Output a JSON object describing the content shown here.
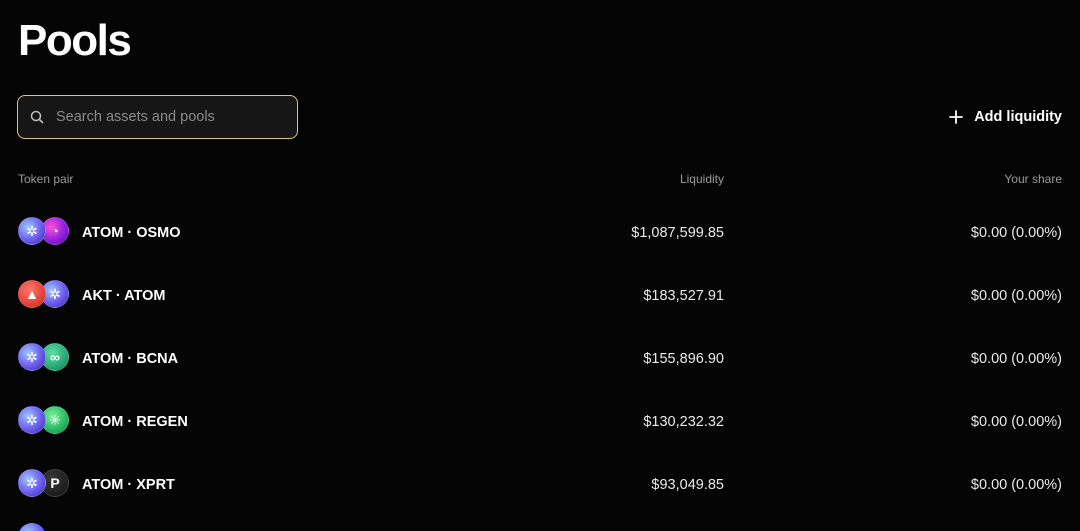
{
  "page": {
    "title": "Pools"
  },
  "search": {
    "placeholder": "Search assets and pools",
    "value": ""
  },
  "actions": {
    "add_liquidity_label": "Add liquidity"
  },
  "table": {
    "headers": {
      "token_pair": "Token pair",
      "liquidity": "Liquidity",
      "your_share": "Your share"
    },
    "rows": [
      {
        "pair": "ATOM · OSMO",
        "liquidity": "$1,087,599.85",
        "share": "$0.00 (0.00%)",
        "token1": "atom",
        "token2": "osmo"
      },
      {
        "pair": "AKT · ATOM",
        "liquidity": "$183,527.91",
        "share": "$0.00 (0.00%)",
        "token1": "akt",
        "token2": "atom"
      },
      {
        "pair": "ATOM · BCNA",
        "liquidity": "$155,896.90",
        "share": "$0.00 (0.00%)",
        "token1": "atom",
        "token2": "bcna"
      },
      {
        "pair": "ATOM · REGEN",
        "liquidity": "$130,232.32",
        "share": "$0.00 (0.00%)",
        "token1": "atom",
        "token2": "regen"
      },
      {
        "pair": "ATOM · XPRT",
        "liquidity": "$93,049.85",
        "share": "$0.00 (0.00%)",
        "token1": "atom",
        "token2": "xprt"
      }
    ]
  },
  "icons": {
    "search": "search-icon",
    "add": "plus-icon",
    "tokens": {
      "atom": "atom-token-icon",
      "osmo": "osmo-token-icon",
      "akt": "akt-token-icon",
      "bcna": "bcna-token-icon",
      "regen": "regen-token-icon",
      "xprt": "xprt-token-icon"
    }
  },
  "colors": {
    "background": "#050505",
    "search_border": "#d7c48a",
    "muted_text": "#9a9a9a"
  }
}
